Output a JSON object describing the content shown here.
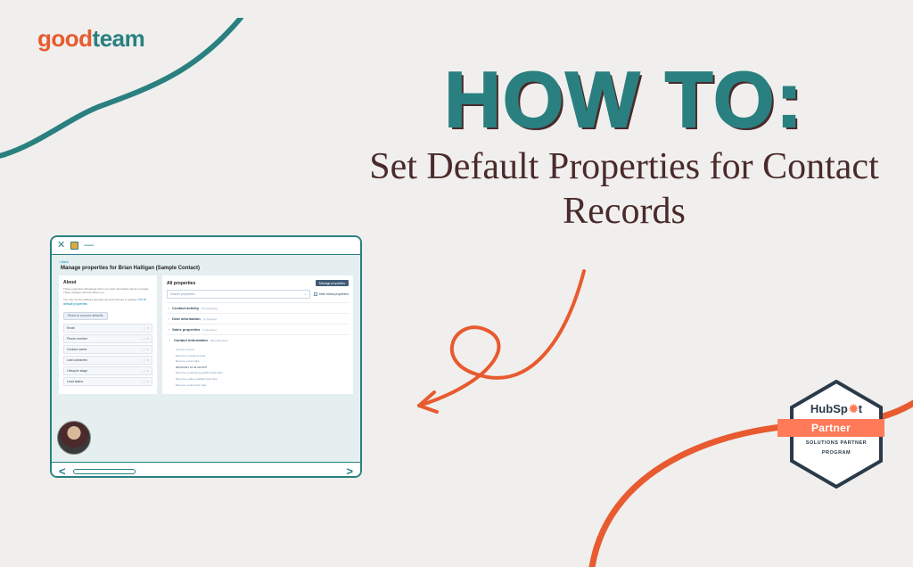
{
  "brand": {
    "part1": "good",
    "part2": "team"
  },
  "headline": {
    "howto": "HOW TO:",
    "subtitle": "Set Default Properties for Contact Records"
  },
  "browser": {
    "back_link": "< Back",
    "page_title": "Manage properties for Brian Halligan (Sample Contact)",
    "about": {
      "heading": "About",
      "description": "These properties will appear when you view information about a contact. These changes will only affect you.",
      "note_prefix": "You may set the default properties all users will see in settings.",
      "settings_link": "Go to default properties",
      "reset_button": "Reset to account defaults"
    },
    "left_properties": [
      "Email",
      "Phone number",
      "Contact owner",
      "Last contacted",
      "Lifecycle stage",
      "Lead status"
    ],
    "all_properties": {
      "heading": "All properties",
      "manage_button": "Manage properties",
      "search_placeholder": "Search properties",
      "hide_blank": "Hide blank properties",
      "groups": [
        {
          "label": "Contact activity",
          "count": "(7 properties)",
          "expanded": false
        },
        {
          "label": "Deal information",
          "count": "(1 property)",
          "expanded": false
        },
        {
          "label": "Sales properties",
          "count": "(1 property)",
          "expanded": false
        },
        {
          "label": "Contact information",
          "count": "(84 properties)",
          "expanded": true
        }
      ],
      "expanded_items": [
        "Annual revenue",
        "Became a customer date",
        "Became a lead date",
        "08/23/2021 10:46 AM PDT",
        "Became a marketing qualified lead date",
        "Became a sales qualified lead date",
        "Became a subscriber date"
      ]
    }
  },
  "badge": {
    "brand": "HubSpot",
    "partner": "Partner",
    "program_line1": "SOLUTIONS PARTNER",
    "program_line2": "PROGRAM"
  },
  "colors": {
    "teal": "#2a8080",
    "orange": "#e85a2f",
    "dark": "#4a2a2a",
    "bg": "#f0efed"
  }
}
